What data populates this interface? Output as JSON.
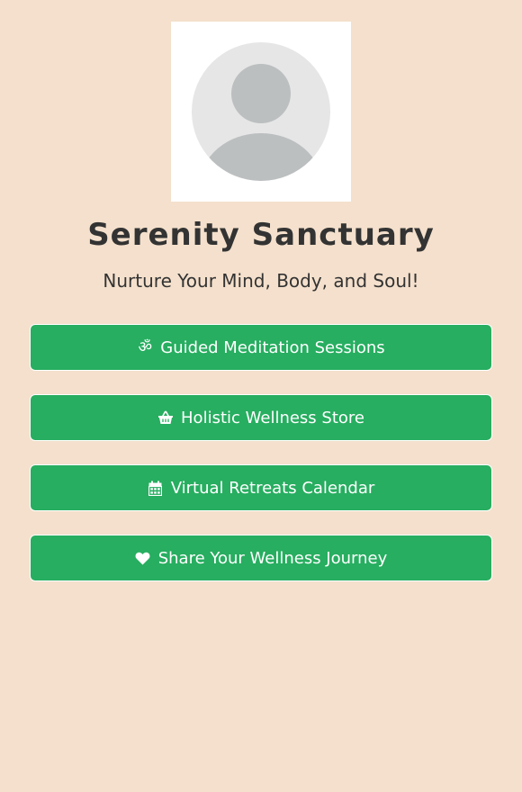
{
  "profile": {
    "title": "Serenity Sanctuary",
    "tagline": "Nurture Your Mind, Body, and Soul!"
  },
  "links": [
    {
      "label": "Guided Meditation Sessions",
      "icon": "om-icon"
    },
    {
      "label": "Holistic Wellness Store",
      "icon": "shopping-basket-icon"
    },
    {
      "label": "Virtual Retreats Calendar",
      "icon": "calendar-icon"
    },
    {
      "label": "Share Your Wellness Journey",
      "icon": "heart-icon"
    }
  ],
  "colors": {
    "background": "#f4e0cc",
    "button": "#27ae60",
    "text": "#333333"
  }
}
